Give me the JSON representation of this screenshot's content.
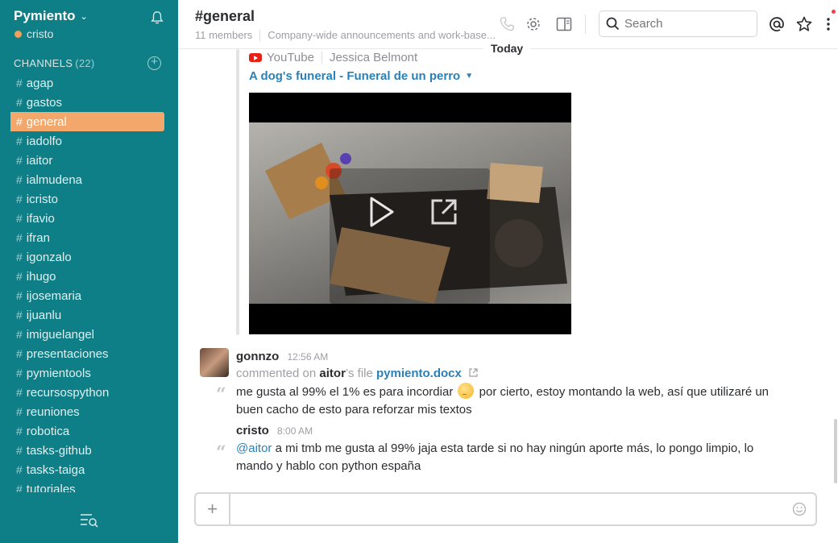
{
  "team": {
    "name": "Pymiento",
    "user": "cristo"
  },
  "sidebar": {
    "channels_label": "CHANNELS",
    "channels_count": "(22)",
    "channels": [
      {
        "name": "agap"
      },
      {
        "name": "gastos"
      },
      {
        "name": "general",
        "active": true
      },
      {
        "name": "iadolfo"
      },
      {
        "name": "iaitor"
      },
      {
        "name": "ialmudena"
      },
      {
        "name": "icristo"
      },
      {
        "name": "ifavio"
      },
      {
        "name": "ifran"
      },
      {
        "name": "igonzalo"
      },
      {
        "name": "ihugo"
      },
      {
        "name": "ijosemaria"
      },
      {
        "name": "ijuanlu"
      },
      {
        "name": "imiguelangel"
      },
      {
        "name": "presentaciones"
      },
      {
        "name": "pymientools"
      },
      {
        "name": "recursospython"
      },
      {
        "name": "reuniones"
      },
      {
        "name": "robotica"
      },
      {
        "name": "tasks-github"
      },
      {
        "name": "tasks-taiga"
      },
      {
        "name": "tutoriales"
      }
    ]
  },
  "header": {
    "title": "#general",
    "members": "11 members",
    "purpose": "Company-wide announcements and work-base...",
    "search_placeholder": "Search"
  },
  "day_divider": "Today",
  "attachment": {
    "service": "YouTube",
    "author": "Jessica Belmont",
    "title": "A dog's funeral - Funeral de un perro"
  },
  "messages": [
    {
      "author": "gonnzo",
      "time": "12:56 AM",
      "sub_prefix": "commented on",
      "sub_user": "aitor",
      "sub_mid": "’s file",
      "sub_file": "pymiento.docx",
      "text_a": "me gusta al 99% el 1% es para incordiar",
      "text_b": "por cierto, estoy montando la web, así que utilizaré un buen cacho de esto para reforzar mis textos"
    },
    {
      "author": "cristo",
      "time": "8:00 AM",
      "mention": "@aitor",
      "text": "a mi tmb me gusta al 99% jaja esta tarde si no hay ningún aporte más, lo pongo limpio, lo mando y hablo con python españa"
    }
  ],
  "colors": {
    "sidebar": "#0e7f87",
    "active_channel": "#f4a76b",
    "link": "#2a80b9"
  }
}
